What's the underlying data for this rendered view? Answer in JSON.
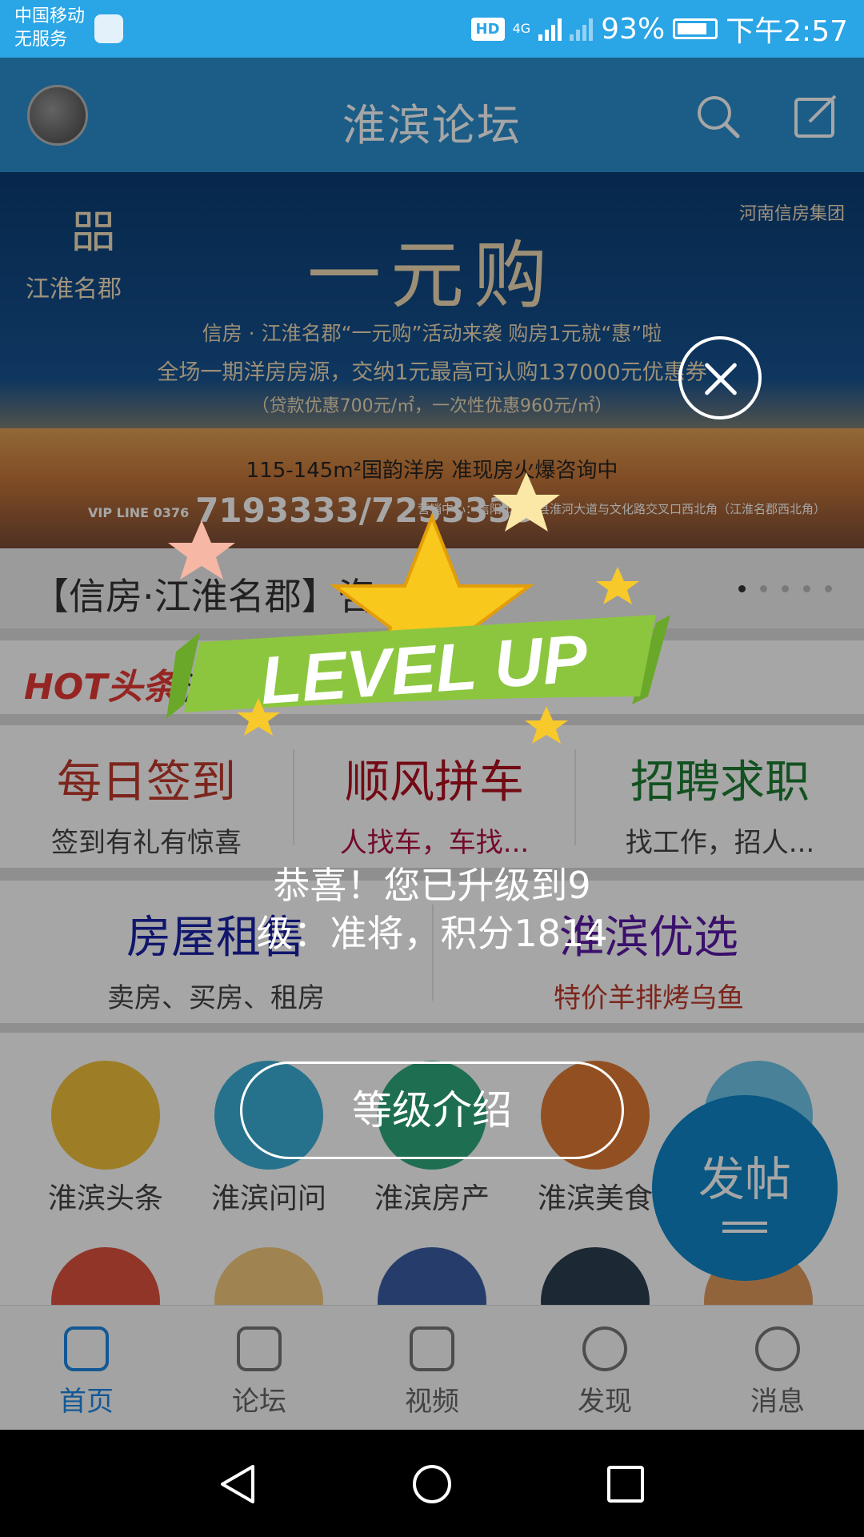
{
  "status_bar": {
    "carrier": "中国移动",
    "service": "无服务",
    "hd": "HD",
    "network": "4G",
    "battery": "93%",
    "time": "下午2:57"
  },
  "app_bar": {
    "title": "淮滨论坛",
    "search_icon": "search-icon",
    "compose_icon": "compose-icon"
  },
  "banner": {
    "logo_mark": "㗊",
    "project_name": "江淮名郡",
    "group": "河南信房集团",
    "title": "一元购",
    "line1": "信房 · 江淮名郡“一元购”活动来袭 购房1元就“惠”啦",
    "line2": "全场一期洋房房源，交纳1元最高可认购137000元优惠券",
    "line3": "（贷款优惠700元/㎡，一次性优惠960元/㎡）",
    "line4": "115-145m²国韵洋房 准现房火爆咨询中",
    "vip_line": "VIP LINE 0376",
    "phone": "7193333/7253333",
    "address": "营销中心：信阳市淮滨县淮河大道与文化路交叉口西北角（江淮名郡西北角）"
  },
  "carousel": {
    "caption": "【信房·江淮名郡】咨",
    "dots": 5,
    "active_dot": 0
  },
  "hot_news": {
    "tag": "HOT头条",
    "text": "淮"
  },
  "quick_links": [
    {
      "title": "每日签到",
      "subtitle": "签到有礼有惊喜",
      "title_color": "#c0392b",
      "subtitle_color": "#444444"
    },
    {
      "title": "顺风拼车",
      "subtitle": "人找车，车找...",
      "title_color": "#b01020",
      "subtitle_color": "#b01040"
    },
    {
      "title": "招聘求职",
      "subtitle": "找工作，招人...",
      "title_color": "#1e7d32",
      "subtitle_color": "#444444"
    },
    {
      "title": "房屋租售",
      "subtitle": "卖房、买房、租房",
      "title_color": "#1a23a6",
      "subtitle_color": "#444444"
    },
    {
      "title": "淮滨优选",
      "subtitle": "特价羊排烤乌鱼",
      "title_color": "#5b1aa6",
      "subtitle_color": "#c0392b"
    }
  ],
  "categories": [
    {
      "label": "淮滨头条",
      "icon": "reader-icon",
      "color": "#f2c23c"
    },
    {
      "label": "淮滨问问",
      "icon": "blocks-icon",
      "color": "#3bb0d9"
    },
    {
      "label": "淮滨房产",
      "icon": "house-icon",
      "color": "#2eaa7d"
    },
    {
      "label": "淮滨美食",
      "icon": "chef-icon",
      "color": "#e07b35"
    },
    {
      "label": "",
      "icon": "person-icon",
      "color": "#6fc6ea"
    }
  ],
  "categories_row2": [
    {
      "icon": "tools-icon",
      "color": "#e05240"
    },
    {
      "icon": "boy-icon",
      "color": "#f4c97c"
    },
    {
      "icon": "girl-icon",
      "color": "#3b5fa7"
    },
    {
      "icon": "notebook-icon",
      "color": "#2c3e50"
    },
    {
      "icon": "bag-icon",
      "color": "#e09a5c"
    }
  ],
  "fab": {
    "label": "发帖"
  },
  "tabs": [
    {
      "label": "首页",
      "icon": "home-icon",
      "active": true
    },
    {
      "label": "论坛",
      "icon": "coffee-icon",
      "active": false
    },
    {
      "label": "视频",
      "icon": "video-icon",
      "active": false
    },
    {
      "label": "发现",
      "icon": "search-icon",
      "active": false
    },
    {
      "label": "消息",
      "icon": "message-icon",
      "active": false
    }
  ],
  "popup": {
    "ribbon": "LEVEL UP",
    "message": "恭喜！您已升级到9级：准将，积分1814",
    "button": "等级介绍"
  }
}
